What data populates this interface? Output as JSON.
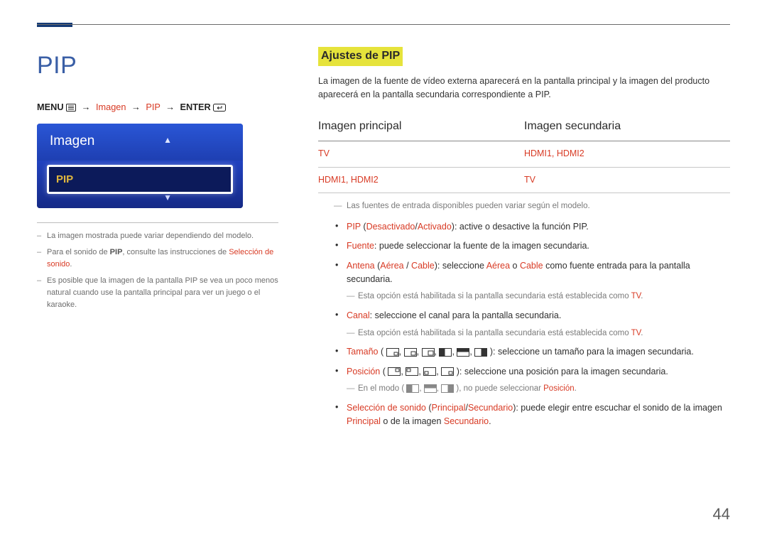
{
  "header": {
    "title": "PIP"
  },
  "breadcrumb": {
    "menu": "MENU",
    "imagen": "Imagen",
    "pip": "PIP",
    "enter": "ENTER"
  },
  "osd_panel": {
    "title": "Imagen",
    "selected": "PIP"
  },
  "left_notes": {
    "n1": "La imagen mostrada puede variar dependiendo del modelo.",
    "n2_a": "Para el sonido de ",
    "n2_b": "PIP",
    "n2_c": ", consulte las instrucciones de ",
    "n2_d": "Selección de sonido",
    "n2_e": ".",
    "n3": "Es posible que la imagen de la pantalla PIP se vea un poco menos natural cuando use la pantalla principal para ver un juego o el karaoke."
  },
  "right": {
    "section_title": "Ajustes de PIP",
    "intro": "La imagen de la fuente de vídeo externa aparecerá en la pantalla principal y la imagen del producto aparecerá en la pantalla secundaria correspondiente a PIP.",
    "table": {
      "col1": "Imagen principal",
      "col2": "Imagen secundaria",
      "r1c1": "TV",
      "r1c2": "HDMI1, HDMI2",
      "r2c1": "HDMI1, HDMI2",
      "r2c2": "TV"
    },
    "src_note": "Las fuentes de entrada disponibles pueden variar según el modelo.",
    "b_pip": {
      "k": "PIP",
      "a": " (",
      "off": "Desactivado",
      "sep": "/",
      "on": "Activado",
      "b": "): active o desactive la función PIP."
    },
    "b_fuente": {
      "k": "Fuente",
      "t": ": puede seleccionar la fuente de la imagen secundaria."
    },
    "b_antena": {
      "k": "Antena",
      "a": " (",
      "aer": "Aérea",
      "sep": " / ",
      "cab": "Cable",
      "b": "): seleccione ",
      "aer2": "Aérea",
      "or": " o ",
      "cab2": "Cable",
      "c": " como fuente entrada para la pantalla secundaria."
    },
    "sub_tv": {
      "a": "Esta opción está habilitada si la pantalla secundaria está establecida como ",
      "tv": "TV",
      "b": "."
    },
    "b_canal": {
      "k": "Canal",
      "t": ": seleccione el canal para la pantalla secundaria."
    },
    "b_tam": {
      "k": "Tamaño",
      "a": " (",
      "b": "): seleccione un tamaño para la imagen secundaria."
    },
    "b_pos": {
      "k": "Posición",
      "a": " (",
      "b": "): seleccione una posición para la imagen secundaria."
    },
    "sub_pos": {
      "a": "En el modo (",
      "b": "), no puede seleccionar ",
      "pos": "Posición",
      "c": "."
    },
    "b_sound": {
      "k": "Selección de sonido",
      "a": " (",
      "p": "Principal",
      "sep": "/",
      "s": "Secundario",
      "b": "): puede elegir entre escuchar el sonido de la imagen ",
      "p2": "Principal",
      "or": " o de la imagen ",
      "s2": "Secundario",
      "c": "."
    }
  },
  "page_number": "44"
}
